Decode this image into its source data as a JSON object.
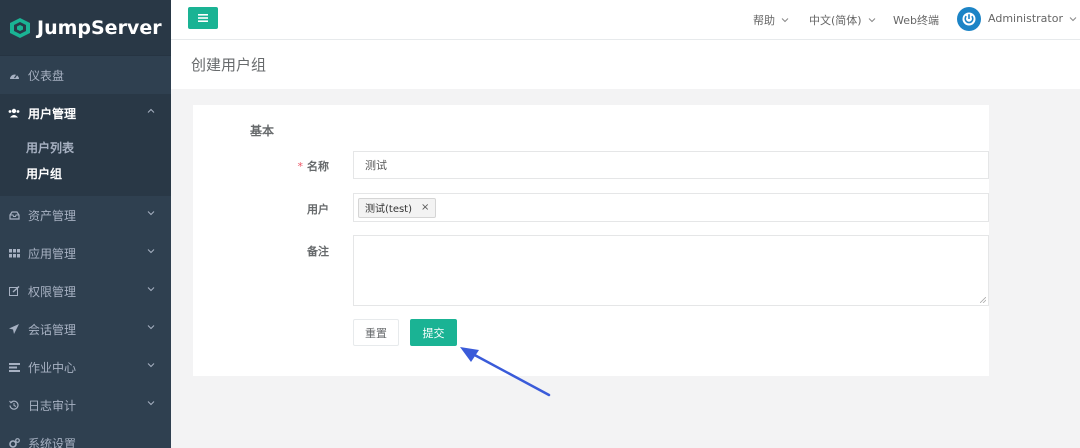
{
  "app": {
    "logo_text": "JumpServer"
  },
  "sidebar": {
    "items": [
      {
        "label": "仪表盘",
        "icon": "dashboard-icon"
      },
      {
        "label": "用户管理",
        "icon": "users-icon",
        "expanded": true,
        "children": [
          {
            "label": "用户列表"
          },
          {
            "label": "用户组",
            "active": true
          }
        ]
      },
      {
        "label": "资产管理",
        "icon": "inbox-icon"
      },
      {
        "label": "应用管理",
        "icon": "grid-icon"
      },
      {
        "label": "权限管理",
        "icon": "edit-icon"
      },
      {
        "label": "会话管理",
        "icon": "rocket-icon"
      },
      {
        "label": "作业中心",
        "icon": "tasks-icon"
      },
      {
        "label": "日志审计",
        "icon": "history-icon"
      },
      {
        "label": "系统设置",
        "icon": "gears-icon"
      }
    ]
  },
  "topbar": {
    "help": "帮助",
    "language": "中文(简体)",
    "web_terminal": "Web终端",
    "user": "Administrator"
  },
  "page": {
    "title": "创建用户组"
  },
  "form": {
    "section": "基本",
    "required_mark": "*",
    "name_label": "名称",
    "name_value": "测试",
    "users_label": "用户",
    "selected_users": [
      {
        "label": "测试(test)",
        "remove": "×"
      }
    ],
    "comment_label": "备注",
    "comment_value": "",
    "reset_label": "重置",
    "submit_label": "提交"
  },
  "colors": {
    "accent": "#1ab394",
    "sidebar_bg": "#2f4050",
    "annotation_arrow": "#3a5bd9",
    "avatar": "#1c84c6"
  }
}
